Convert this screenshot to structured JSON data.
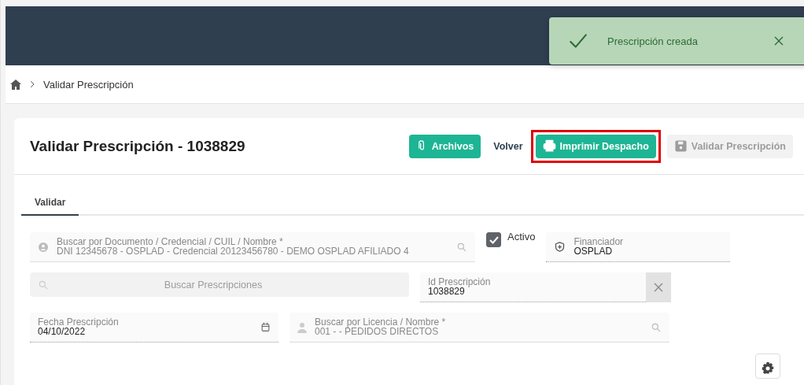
{
  "toast": {
    "message": "Prescripción creada"
  },
  "breadcrumb": {
    "current": "Validar Prescripción"
  },
  "card": {
    "title": "Validar Prescripción - 1038829",
    "actions": [
      {
        "kind": "attach",
        "label": "Archivos",
        "highlighted": false,
        "disabled": false
      },
      {
        "kind": "back",
        "label": "Volver",
        "highlighted": false,
        "disabled": false
      },
      {
        "kind": "print",
        "label": "Imprimir Despacho",
        "highlighted": true,
        "disabled": false
      },
      {
        "kind": "validate",
        "label": "Validar Prescripción",
        "highlighted": false,
        "disabled": true
      }
    ]
  },
  "tabs": [
    {
      "label": "Validar",
      "selected": true
    }
  ],
  "form": {
    "document": {
      "label": "Buscar por Documento / Credencial / CUIL / Nombre *",
      "value": "DNI 12345678 - OSPLAD - Credencial 20123456780 - DEMO OSPLAD AFILIADO 4"
    },
    "active": {
      "label": "Activo",
      "checked": true
    },
    "financier": {
      "label": "Financiador",
      "value": "OSPLAD"
    },
    "search_button": {
      "label": "Buscar Prescripciones",
      "disabled": true
    },
    "prescription_id": {
      "label": "Id Prescripción",
      "value": "1038829"
    },
    "date": {
      "label": "Fecha Prescripción",
      "value": "04/10/2022"
    },
    "license": {
      "label": "Buscar por Licencia / Nombre *",
      "value": "001 -  - PEDIDOS DIRECTOS"
    }
  }
}
